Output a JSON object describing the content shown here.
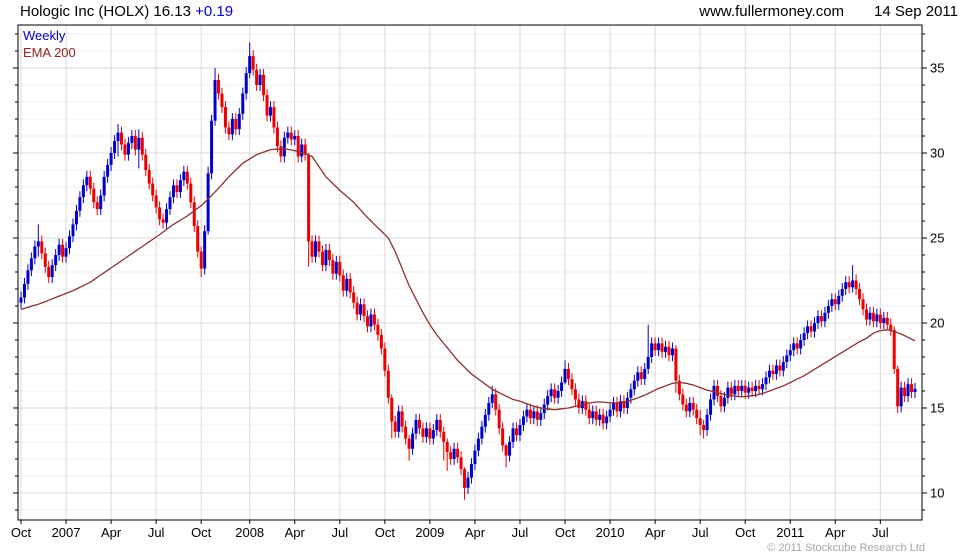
{
  "header": {
    "title": "Hologic Inc (HOLX) 16.13",
    "change": "+0.19",
    "site": "www.fullermoney.com",
    "date": "14 Sep 2011"
  },
  "legend": {
    "mode": "Weekly",
    "overlay": "EMA 200"
  },
  "footer": {
    "copyright": "© 2011 Stockcube Research Ltd"
  },
  "colors": {
    "up_candle": "#0000cc",
    "down_candle": "#ee0000",
    "ema_line": "#8b3030",
    "grid_major": "#d9d9d9",
    "grid_minor": "#efefef",
    "axis": "#000000",
    "tick_label": "#000000",
    "change_text": "#0000cc",
    "legend_mode": "#0000bb",
    "legend_ema": "#992222",
    "copyright": "#a6a6a6"
  },
  "chart_data": {
    "type": "candlestick",
    "title": "Hologic Inc (HOLX) weekly candlestick chart with EMA 200 overlay",
    "x_unit": "week",
    "range_label": "Oct 2006 - 14 Sep 2011",
    "grid": true,
    "legend_position": "top-left",
    "ylim": [
      8.41,
      37.53
    ],
    "y_ticks": [
      10,
      15,
      20,
      25,
      30,
      35
    ],
    "y_minor_step": 1,
    "x_ticks": [
      [
        0,
        "Oct"
      ],
      [
        13,
        "2007"
      ],
      [
        26,
        "Apr"
      ],
      [
        39,
        "Jul"
      ],
      [
        52,
        "Oct"
      ],
      [
        66,
        "2008"
      ],
      [
        79,
        "Apr"
      ],
      [
        92,
        "Jul"
      ],
      [
        105,
        "Oct"
      ],
      [
        118,
        "2009"
      ],
      [
        131,
        "Apr"
      ],
      [
        144,
        "Jul"
      ],
      [
        157,
        "Oct"
      ],
      [
        170,
        "2010"
      ],
      [
        183,
        "Apr"
      ],
      [
        196,
        "Jul"
      ],
      [
        209,
        "Oct"
      ],
      [
        222,
        "2011"
      ],
      [
        235,
        "Apr"
      ],
      [
        248,
        "Jul"
      ]
    ],
    "first_open": 21.2,
    "default_wick": 0.35,
    "closes": [
      21.5,
      22.3,
      23.1,
      23.8,
      24.5,
      24.8,
      24.1,
      23.3,
      22.7,
      23.4,
      24.0,
      24.6,
      23.9,
      24.4,
      25.1,
      25.8,
      26.6,
      27.4,
      28.1,
      28.6,
      27.9,
      27.1,
      26.7,
      27.5,
      28.6,
      29.3,
      30.0,
      30.7,
      31.2,
      30.5,
      29.9,
      30.6,
      31.0,
      30.2,
      30.9,
      29.9,
      29.0,
      28.2,
      27.5,
      26.8,
      26.1,
      25.9,
      26.7,
      27.4,
      28.1,
      27.7,
      28.4,
      28.9,
      28.2,
      27.1,
      25.7,
      24.2,
      23.2,
      25.4,
      28.8,
      31.9,
      34.3,
      33.5,
      32.7,
      31.5,
      31.1,
      32.0,
      31.4,
      32.3,
      33.5,
      34.7,
      35.7,
      34.9,
      34.0,
      34.6,
      33.4,
      32.2,
      32.7,
      31.5,
      30.4,
      29.8,
      30.9,
      31.2,
      30.8,
      31.0,
      29.8,
      30.5,
      29.9,
      24.8,
      23.9,
      24.8,
      24.2,
      23.4,
      24.3,
      23.7,
      22.9,
      23.6,
      22.8,
      21.9,
      22.6,
      21.8,
      21.2,
      20.5,
      21.1,
      20.4,
      19.8,
      20.5,
      19.9,
      19.3,
      18.5,
      17.2,
      15.6,
      14.2,
      13.6,
      14.8,
      13.9,
      13.2,
      12.6,
      13.5,
      14.3,
      13.8,
      13.3,
      13.8,
      13.2,
      13.7,
      14.3,
      13.6,
      13.0,
      12.4,
      12.0,
      12.6,
      12.1,
      11.4,
      10.3,
      10.9,
      11.7,
      12.5,
      13.2,
      13.9,
      14.6,
      15.3,
      15.8,
      14.9,
      13.8,
      12.8,
      12.2,
      13.0,
      13.8,
      13.4,
      14.0,
      14.5,
      14.9,
      14.4,
      14.8,
      14.3,
      14.7,
      15.2,
      15.7,
      16.1,
      15.6,
      16.0,
      16.5,
      17.3,
      16.7,
      16.1,
      15.5,
      15.0,
      15.4,
      14.9,
      14.4,
      14.8,
      14.3,
      14.6,
      14.1,
      14.5,
      14.9,
      15.3,
      14.8,
      15.4,
      15.0,
      15.6,
      16.1,
      16.6,
      17.1,
      16.7,
      17.3,
      18.0,
      18.8,
      18.4,
      18.8,
      18.3,
      18.6,
      18.1,
      18.5,
      16.6,
      15.8,
      15.2,
      14.8,
      15.3,
      14.9,
      14.4,
      14.0,
      13.7,
      14.6,
      15.5,
      16.3,
      15.7,
      15.1,
      15.6,
      16.2,
      15.8,
      16.3,
      16.0,
      16.3,
      15.9,
      16.2,
      16.0,
      16.3,
      16.1,
      16.4,
      16.8,
      17.2,
      17.0,
      17.5,
      17.2,
      17.7,
      18.1,
      18.4,
      18.8,
      18.5,
      19.0,
      19.4,
      19.8,
      19.5,
      20.0,
      20.4,
      20.1,
      20.6,
      21.0,
      21.4,
      21.1,
      21.6,
      22.0,
      22.4,
      22.1,
      22.5,
      22.0,
      21.4,
      20.8,
      20.2,
      20.6,
      20.1,
      20.5,
      20.0,
      20.3,
      19.9,
      19.6,
      17.3,
      15.1,
      16.2,
      15.7,
      16.4,
      15.94,
      16.13
    ],
    "special_wicks": {
      "5": [
        25.8,
        23.9
      ],
      "28": [
        31.7,
        29.8
      ],
      "34": [
        31.4,
        29.1
      ],
      "52": [
        24.5,
        22.7
      ],
      "54": [
        29.2,
        25.2
      ],
      "56": [
        35.0,
        31.6
      ],
      "66": [
        36.5,
        34.4
      ],
      "83": [
        30.0,
        23.3
      ],
      "107": [
        15.8,
        13.2
      ],
      "112": [
        13.4,
        11.9
      ],
      "122": [
        13.9,
        11.9
      ],
      "123": [
        13.2,
        11.3
      ],
      "128": [
        11.5,
        9.6
      ],
      "136": [
        16.3,
        15.0
      ],
      "140": [
        12.9,
        11.5
      ],
      "157": [
        17.8,
        16.4
      ],
      "181": [
        19.9,
        17.0
      ],
      "189": [
        18.7,
        15.9
      ],
      "196": [
        14.9,
        13.4
      ],
      "197": [
        14.3,
        13.2
      ],
      "240": [
        23.4,
        21.8
      ],
      "252": [
        19.8,
        17.0
      ],
      "253": [
        17.5,
        14.7
      ]
    },
    "ema200": [
      [
        0,
        20.8
      ],
      [
        5,
        21.1
      ],
      [
        10,
        21.5
      ],
      [
        15,
        21.9
      ],
      [
        20,
        22.4
      ],
      [
        25,
        23.1
      ],
      [
        30,
        23.8
      ],
      [
        35,
        24.5
      ],
      [
        40,
        25.2
      ],
      [
        44,
        25.8
      ],
      [
        48,
        26.3
      ],
      [
        52,
        26.9
      ],
      [
        56,
        27.7
      ],
      [
        60,
        28.6
      ],
      [
        64,
        29.4
      ],
      [
        68,
        29.9
      ],
      [
        72,
        30.2
      ],
      [
        76,
        30.25
      ],
      [
        80,
        30.1
      ],
      [
        84,
        29.8
      ],
      [
        88,
        28.6
      ],
      [
        92,
        27.8
      ],
      [
        96,
        27.1
      ],
      [
        100,
        26.2
      ],
      [
        104,
        25.4
      ],
      [
        106,
        25.0
      ],
      [
        108,
        24.2
      ],
      [
        110,
        23.2
      ],
      [
        112,
        22.2
      ],
      [
        114,
        21.4
      ],
      [
        116,
        20.6
      ],
      [
        118,
        19.9
      ],
      [
        120,
        19.3
      ],
      [
        122,
        18.8
      ],
      [
        124,
        18.3
      ],
      [
        126,
        17.8
      ],
      [
        128,
        17.4
      ],
      [
        130,
        17.0
      ],
      [
        132,
        16.7
      ],
      [
        134,
        16.4
      ],
      [
        136,
        16.1
      ],
      [
        138,
        15.9
      ],
      [
        140,
        15.7
      ],
      [
        142,
        15.5
      ],
      [
        144,
        15.4
      ],
      [
        146,
        15.25
      ],
      [
        148,
        15.1
      ],
      [
        150,
        15.0
      ],
      [
        152,
        14.95
      ],
      [
        154,
        14.9
      ],
      [
        156,
        14.95
      ],
      [
        158,
        15.0
      ],
      [
        160,
        15.1
      ],
      [
        162,
        15.2
      ],
      [
        164,
        15.3
      ],
      [
        166,
        15.35
      ],
      [
        168,
        15.35
      ],
      [
        170,
        15.3
      ],
      [
        172,
        15.3
      ],
      [
        174,
        15.35
      ],
      [
        176,
        15.45
      ],
      [
        178,
        15.6
      ],
      [
        180,
        15.75
      ],
      [
        182,
        15.95
      ],
      [
        184,
        16.15
      ],
      [
        186,
        16.3
      ],
      [
        188,
        16.45
      ],
      [
        190,
        16.5
      ],
      [
        192,
        16.45
      ],
      [
        194,
        16.35
      ],
      [
        196,
        16.2
      ],
      [
        198,
        16.05
      ],
      [
        200,
        15.95
      ],
      [
        202,
        15.85
      ],
      [
        204,
        15.75
      ],
      [
        206,
        15.7
      ],
      [
        208,
        15.65
      ],
      [
        210,
        15.7
      ],
      [
        212,
        15.75
      ],
      [
        214,
        15.85
      ],
      [
        216,
        16.0
      ],
      [
        218,
        16.15
      ],
      [
        220,
        16.3
      ],
      [
        222,
        16.5
      ],
      [
        224,
        16.7
      ],
      [
        226,
        16.9
      ],
      [
        228,
        17.15
      ],
      [
        230,
        17.4
      ],
      [
        232,
        17.65
      ],
      [
        234,
        17.9
      ],
      [
        236,
        18.15
      ],
      [
        238,
        18.4
      ],
      [
        240,
        18.65
      ],
      [
        242,
        18.9
      ],
      [
        244,
        19.1
      ],
      [
        246,
        19.4
      ],
      [
        248,
        19.55
      ],
      [
        250,
        19.6
      ],
      [
        252,
        19.5
      ],
      [
        254,
        19.35
      ],
      [
        256,
        19.15
      ],
      [
        258,
        18.95
      ]
    ]
  }
}
